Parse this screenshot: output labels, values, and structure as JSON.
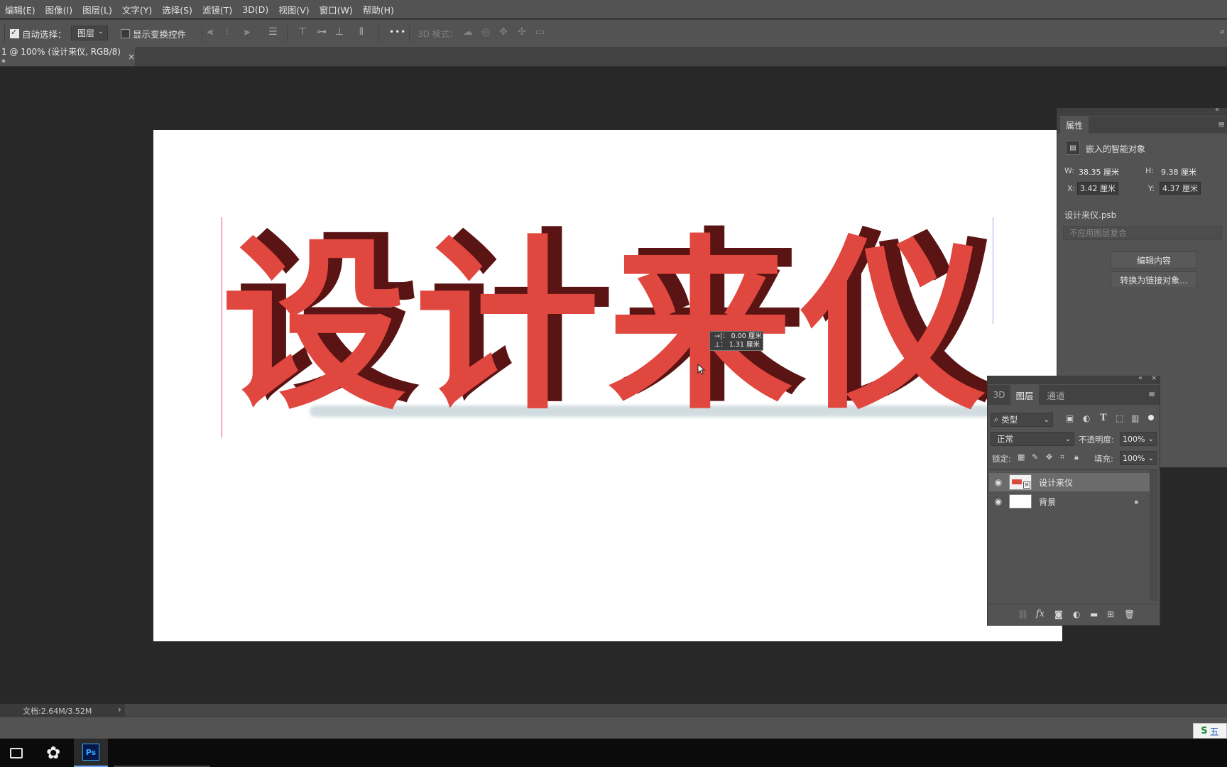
{
  "menu": [
    "编辑(E)",
    "图像(I)",
    "图层(L)",
    "文字(Y)",
    "选择(S)",
    "滤镜(T)",
    "3D(D)",
    "视图(V)",
    "窗口(W)",
    "帮助(H)"
  ],
  "options": {
    "auto_select_label": "自动选择：",
    "auto_select_value": "图层",
    "show_transform_label": "显示变换控件",
    "more_label": "•••",
    "mode_3d_label": "3D 模式："
  },
  "tab": {
    "title": "1 @ 100% (设计来仪, RGB/8) *",
    "close": "×"
  },
  "canvas": {
    "headline_chars": [
      "设",
      "计",
      "来",
      "仪"
    ],
    "face_color": "#e0473f",
    "extrude_color": "#5a1414",
    "tooltip_line1": "→|：  0.00 厘米",
    "tooltip_line2": "⊥：  1.31 厘米"
  },
  "properties": {
    "tab": "属性",
    "type_label": "嵌入的智能对象",
    "w_label": "W:",
    "w_value": "38.35 厘米",
    "h_label": "H:",
    "h_value": "9.38 厘米",
    "x_label": "X:",
    "x_value": "3.42 厘米",
    "y_label": "Y:",
    "y_value": "4.37 厘米",
    "filename": "设计来仪.psb",
    "comp_placeholder": "不应用图层复合",
    "edit_button": "编辑内容",
    "convert_button": "转换为链接对象..."
  },
  "layers": {
    "tabs": [
      "3D",
      "图层",
      "通道"
    ],
    "active_tab": "图层",
    "filter_label": "类型",
    "blend_mode": "正常",
    "opacity_label": "不透明度:",
    "opacity_value": "100%",
    "lock_label": "锁定:",
    "fill_label": "填充:",
    "fill_value": "100%",
    "items": [
      {
        "name": "设计来仪",
        "selected": true
      },
      {
        "name": "背景",
        "selected": false
      }
    ]
  },
  "status": {
    "doc_info": "文档:2.64M/3.52M",
    "arrow": "›"
  },
  "taskbar": {
    "ps_label": "Ps",
    "ime_label": "五"
  }
}
